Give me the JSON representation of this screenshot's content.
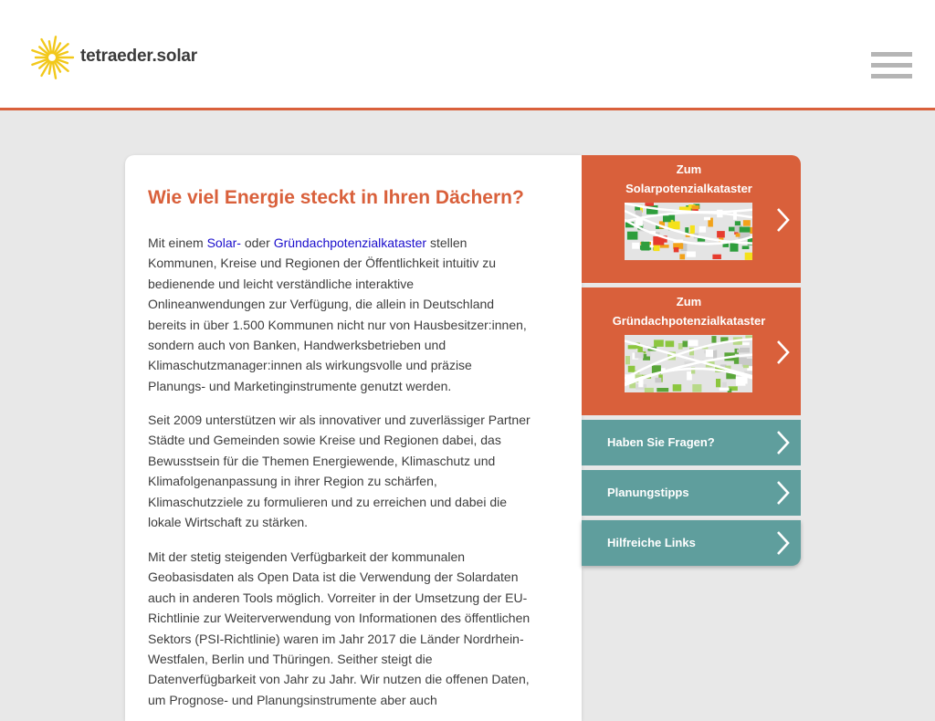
{
  "brand": {
    "name": "tetraeder.solar",
    "logo_color": "#f2c81a"
  },
  "colors": {
    "accent": "#d9603b",
    "teal": "#5f9e9d",
    "link": "#1a0dcc"
  },
  "main": {
    "heading": "Wie viel Energie steckt in Ihren Dächern?",
    "p1": {
      "t1": "Mit einem ",
      "link1": "Solar-",
      "t2": " oder ",
      "link2": "Gründachpotenzialkataster",
      "t3": " stellen Kommunen, Kreise und Regionen der Öffentlichkeit intuitiv zu bedienende und leicht verständliche interaktive Onlineanwendungen zur Verfügung, die allein in Deutschland bereits in über 1.500 Kommunen nicht nur von Hausbesitzer:innen, sondern auch von Banken, Handwerksbetrieben und Klimaschutzmanager:innen als wirkungsvolle und präzise Planungs- und Marketinginstrumente genutzt werden."
    },
    "p2": "Seit 2009 unterstützen wir als innovativer und zuverlässiger Partner Städte und Gemeinden sowie Kreise und Regionen dabei, das Bewusstsein für die Themen Energiewende, Klimaschutz und Klimafolgenanpassung in ihrer Region zu schärfen, Klimaschutzziele zu formulieren und zu erreichen und dabei die lokale Wirtschaft zu stärken.",
    "p3": "Mit der stetig steigenden Verfügbarkeit der kommunalen Geobasisdaten als Open Data ist die Verwendung der Solardaten auch in anderen Tools möglich. Vorreiter in der Umsetzung der EU-Richtlinie zur Weiterverwendung von Informationen des öffentlichen Sektors (PSI-Richtlinie) waren im Jahr 2017 die Länder Nordrhein-Westfalen, Berlin und Thüringen. Seither steigt die Datenverfügbarkeit von Jahr zu Jahr. Wir nutzen die offenen Daten, um Prognose- und Planungsinstrumente aber auch"
  },
  "sidebar": {
    "solar": {
      "line1": "Zum",
      "line2": "Solarpotenzialkataster"
    },
    "gruen": {
      "line1": "Zum",
      "line2": "Gründachpotenzialkataster"
    },
    "links": [
      {
        "label": "Haben Sie Fragen?"
      },
      {
        "label": "Planungstipps"
      },
      {
        "label": "Hilfreiche Links"
      }
    ]
  }
}
